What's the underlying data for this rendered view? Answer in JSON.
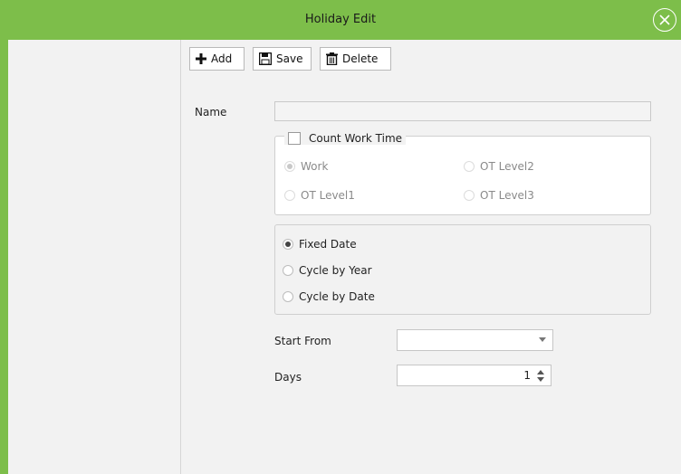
{
  "window": {
    "title": "Holiday Edit",
    "accent_color": "#7dbe4a"
  },
  "toolbar": {
    "add_label": "Add",
    "save_label": "Save",
    "delete_label": "Delete"
  },
  "form": {
    "name_label": "Name",
    "name_value": "",
    "count_work_time": {
      "label": "Count Work Time",
      "checked": false
    },
    "work_options": [
      {
        "label": "Work",
        "selected": true
      },
      {
        "label": "OT Level2",
        "selected": false
      },
      {
        "label": "OT Level1",
        "selected": false
      },
      {
        "label": "OT Level3",
        "selected": false
      }
    ],
    "date_type_options": [
      {
        "label": "Fixed Date",
        "selected": true
      },
      {
        "label": "Cycle by Year",
        "selected": false
      },
      {
        "label": "Cycle by Date",
        "selected": false
      }
    ],
    "start_from_label": "Start From",
    "start_from_value": "",
    "days_label": "Days",
    "days_value": "1"
  }
}
